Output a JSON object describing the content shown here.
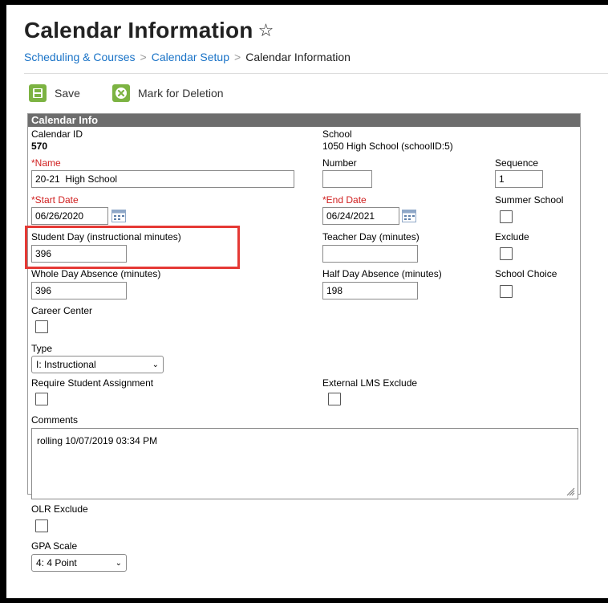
{
  "header": {
    "title": "Calendar Information",
    "star_icon": "☆",
    "breadcrumb": [
      "Scheduling & Courses",
      "Calendar Setup",
      "Calendar Information"
    ]
  },
  "toolbar": {
    "save_label": "Save",
    "delete_label": "Mark for Deletion"
  },
  "panel": {
    "title": "Calendar Info",
    "calendar_id": {
      "label": "Calendar ID",
      "value": "570"
    },
    "school": {
      "label": "School",
      "value": "1050 High School (schoolID:5)"
    },
    "name": {
      "label": "*Name",
      "value": "20-21  High School"
    },
    "number": {
      "label": "Number",
      "value": ""
    },
    "sequence": {
      "label": "Sequence",
      "value": "1"
    },
    "start_date": {
      "label": "*Start Date",
      "value": "06/26/2020"
    },
    "end_date": {
      "label": "*End Date",
      "value": "06/24/2021"
    },
    "summer_school": {
      "label": "Summer School",
      "checked": false
    },
    "student_day": {
      "label": "Student Day (instructional minutes)",
      "value": "396"
    },
    "teacher_day": {
      "label": "Teacher Day (minutes)",
      "value": ""
    },
    "exclude": {
      "label": "Exclude",
      "checked": false
    },
    "whole_day_absence": {
      "label": "Whole Day Absence (minutes)",
      "value": "396"
    },
    "half_day_absence": {
      "label": "Half Day Absence (minutes)",
      "value": "198"
    },
    "school_choice": {
      "label": "School Choice",
      "checked": false
    },
    "career_center": {
      "label": "Career Center",
      "checked": false
    },
    "type": {
      "label": "Type",
      "selected": "I: Instructional"
    },
    "require_student_assignment": {
      "label": "Require Student Assignment",
      "checked": false
    },
    "external_lms_exclude": {
      "label": "External LMS Exclude",
      "checked": false
    },
    "comments": {
      "label": "Comments",
      "value": "rolling 10/07/2019 03:34 PM"
    },
    "olr_exclude": {
      "label": "OLR Exclude",
      "checked": false
    },
    "gpa_scale": {
      "label": "GPA Scale",
      "selected": "4: 4 Point"
    }
  },
  "colors": {
    "link": "#1a73c7",
    "required": "#d02020",
    "button_green": "#7cb342",
    "panel_header": "#6d6d6d",
    "highlight": "#e53935"
  }
}
